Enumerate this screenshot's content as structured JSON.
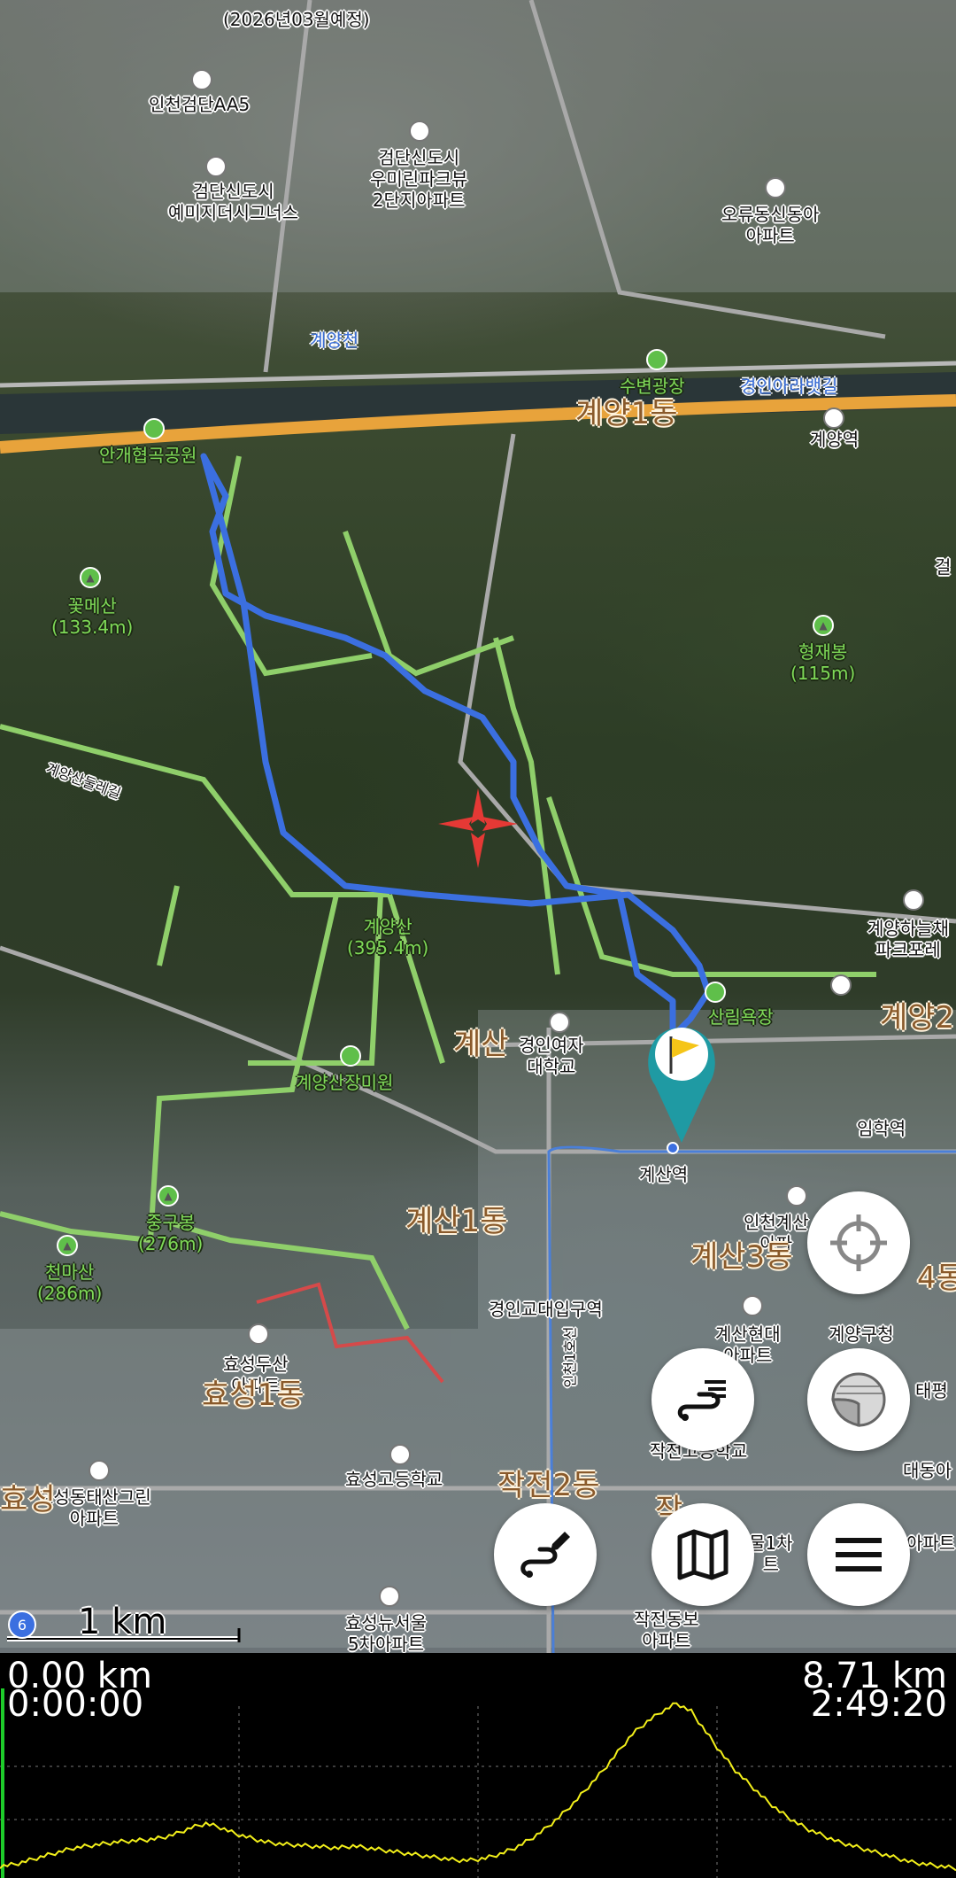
{
  "map": {
    "labels": [
      {
        "id": "l1",
        "text": "(2026년03월예정)",
        "style": ""
      },
      {
        "id": "l2",
        "text": "인천검단AA5",
        "style": ""
      },
      {
        "id": "l3",
        "text": "검단신도시\n우미린파크뷰\n2단지아파트",
        "style": ""
      },
      {
        "id": "l4",
        "text": "검단신도시\n예미지더시그너스",
        "style": ""
      },
      {
        "id": "l5",
        "text": "오류동신동아\n아파트",
        "style": ""
      },
      {
        "id": "l6",
        "text": "계양천",
        "style": "blue"
      },
      {
        "id": "l7",
        "text": "수변광장",
        "style": "green"
      },
      {
        "id": "l8",
        "text": "경인아라뱃길",
        "style": "blue"
      },
      {
        "id": "l9",
        "text": "계양1동",
        "style": "big"
      },
      {
        "id": "l10",
        "text": "계양역",
        "style": ""
      },
      {
        "id": "l11",
        "text": "안개협곡공원",
        "style": "green"
      },
      {
        "id": "l12",
        "text": "꽃메산\n(133.4m)",
        "style": "green"
      },
      {
        "id": "l13",
        "text": "형재봉\n(115m)",
        "style": "green"
      },
      {
        "id": "l14",
        "text": "계양산\n(395.4m)",
        "style": "green"
      },
      {
        "id": "l15",
        "text": "계양하늘채\n파크포레",
        "style": ""
      },
      {
        "id": "l16",
        "text": "산림욕장",
        "style": "green"
      },
      {
        "id": "l17",
        "text": "계양2",
        "style": "big"
      },
      {
        "id": "l18",
        "text": "계산",
        "style": "big"
      },
      {
        "id": "l19",
        "text": "경인여자\n대학교",
        "style": ""
      },
      {
        "id": "l20",
        "text": "계양산장미원",
        "style": "green"
      },
      {
        "id": "l21",
        "text": "임학역",
        "style": ""
      },
      {
        "id": "l22",
        "text": "계산역",
        "style": ""
      },
      {
        "id": "l23",
        "text": "중구봉\n(276m)",
        "style": "green"
      },
      {
        "id": "l24",
        "text": "천마산\n(286m)",
        "style": "green"
      },
      {
        "id": "l25",
        "text": "계산1동",
        "style": "big"
      },
      {
        "id": "l26",
        "text": "인천계산\n아파",
        "style": ""
      },
      {
        "id": "l27",
        "text": "계산3동",
        "style": "big"
      },
      {
        "id": "l28",
        "text": "경인교대입구역",
        "style": ""
      },
      {
        "id": "l29",
        "text": "계산현대\n아파트",
        "style": ""
      },
      {
        "id": "l30",
        "text": "계양구청",
        "style": ""
      },
      {
        "id": "l31",
        "text": "효성두산\n아파트",
        "style": ""
      },
      {
        "id": "l32",
        "text": "효성1동",
        "style": "big"
      },
      {
        "id": "l33",
        "text": "작전2동",
        "style": "big"
      },
      {
        "id": "l34",
        "text": "효성동태산그린\n아파트",
        "style": ""
      },
      {
        "id": "l35",
        "text": "효성고등학교",
        "style": ""
      },
      {
        "id": "l36",
        "text": "효성뉴서울\n5차아파트",
        "style": ""
      },
      {
        "id": "l37",
        "text": "작전동보\n아파트",
        "style": ""
      },
      {
        "id": "l38",
        "text": "대동아",
        "style": ""
      },
      {
        "id": "l39",
        "text": "태평",
        "style": ""
      },
      {
        "id": "l40",
        "text": "작전고등학교",
        "style": ""
      },
      {
        "id": "l41",
        "text": "아파트",
        "style": ""
      },
      {
        "id": "l42",
        "text": "물1차\n트",
        "style": ""
      },
      {
        "id": "l43",
        "text": "4동",
        "style": "big"
      },
      {
        "id": "l44",
        "text": "걸",
        "style": ""
      },
      {
        "id": "l45",
        "text": "계양산둘레길",
        "style": ""
      },
      {
        "id": "l46",
        "text": "인천1호선",
        "style": ""
      },
      {
        "id": "l47",
        "text": "효성",
        "style": "big"
      },
      {
        "id": "l48",
        "text": "작",
        "style": ""
      }
    ],
    "scale": {
      "label": "1 km",
      "zoom_badge": "6"
    },
    "buttons": {
      "locate": "crosshair-icon",
      "layers": "layers-icon",
      "route_list": "route-list-icon",
      "draw_route": "route-draw-icon",
      "map": "map-icon",
      "menu": "menu-icon"
    },
    "colors": {
      "track": "#3b6fe0",
      "trail": "#8fcf6a",
      "road": "#bdbdbd",
      "marker": "#1f9aa3",
      "flag": "#f5c518",
      "crosshair": "#e53935"
    }
  },
  "profile": {
    "start_distance": "0.00 km",
    "start_time": "0:00:00",
    "end_distance": "8.71 km",
    "end_time": "2:49:20",
    "line_color": "#f2ef1a",
    "elevations": [
      8,
      10,
      14,
      18,
      22,
      26,
      28,
      30,
      32,
      33,
      34,
      36,
      40,
      46,
      50,
      46,
      40,
      36,
      32,
      30,
      29,
      28,
      27,
      26,
      28,
      26,
      24,
      22,
      20,
      18,
      16,
      14,
      14,
      16,
      20,
      26,
      34,
      44,
      56,
      70,
      86,
      102,
      120,
      138,
      150,
      160,
      168,
      160,
      140,
      120,
      102,
      88,
      74,
      62,
      52,
      44,
      38,
      32,
      28,
      24,
      20,
      16,
      12,
      10,
      8,
      6
    ]
  }
}
